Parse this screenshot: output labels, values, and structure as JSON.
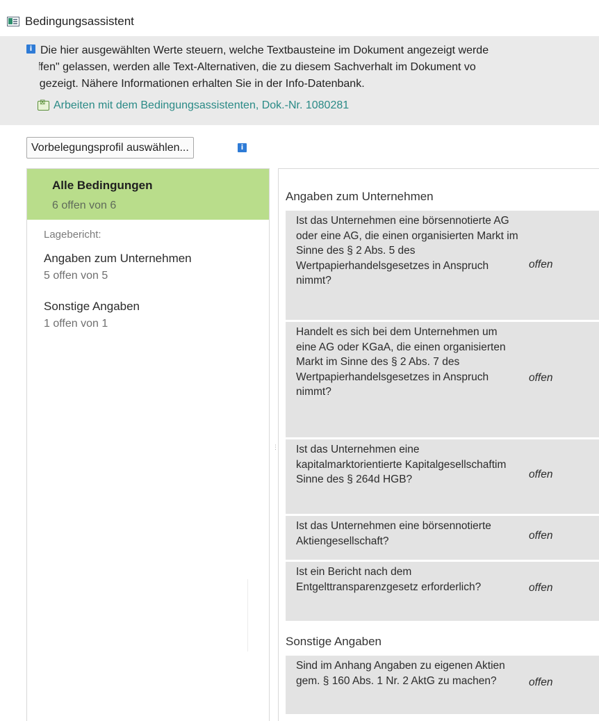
{
  "window": {
    "title": "Bedingungsassistent"
  },
  "banner": {
    "lines": [
      "Die hier ausgewählten Werte steuern, welche Textbausteine im Dokument angezeigt werde",
      "\"offen\" gelassen, werden alle Text-Alternativen, die zu diesem Sachverhalt im Dokument vo",
      "angezeigt. Nähere Informationen erhalten Sie in der Info-Datenbank."
    ],
    "link": "Arbeiten mit dem Bedingungsassistenten, Dok.-Nr. 1080281"
  },
  "profile_button": {
    "label": "Vorbelegungsprofil auswählen..."
  },
  "nav": {
    "all": {
      "label": "Alle Bedingungen",
      "count": "6 offen von 6"
    },
    "section_label": "Lagebericht:",
    "items": [
      {
        "label": "Angaben zum Unternehmen",
        "count": "5 offen von 5"
      },
      {
        "label": "Sonstige Angaben",
        "count": "1 offen von 1"
      }
    ]
  },
  "panel": {
    "sections": [
      {
        "title": "Angaben zum Unternehmen",
        "rows": [
          {
            "question": "Ist das Unternehmen eine börsennotierte AG oder eine AG, die einen organisierten Markt im Sinne des § 2 Abs. 5 des Wertpapierhandelsgesetzes in Anspruch nimmt?",
            "value": "offen"
          },
          {
            "question": "Handelt es sich bei dem Unternehmen um eine AG oder KGaA, die einen organisierten Markt im Sinne des § 2 Abs. 7 des Wertpapierhandelsgesetzes in Anspruch nimmt?",
            "value": "offen"
          },
          {
            "question": "Ist das Unternehmen eine kapitalmarktorientierte Kapitalgesellschaftim Sinne des § 264d HGB?",
            "value": "offen"
          },
          {
            "question": "Ist das Unternehmen eine börsennotierte Aktiengesellschaft?",
            "value": "offen"
          },
          {
            "question": "Ist ein Bericht nach dem Entgelttransparenzgesetz erforderlich?",
            "value": "offen"
          }
        ]
      },
      {
        "title": "Sonstige Angaben",
        "rows": [
          {
            "question": "Sind im Anhang Angaben zu eigenen Aktien gem. § 160 Abs. 1 Nr. 2 AktG zu machen?",
            "value": "offen"
          }
        ]
      }
    ]
  },
  "colors": {
    "nav_selected": "#b9dd8b",
    "banner_bg": "#eaeaea",
    "row_bg": "#e3e3e3",
    "link": "#2a8a86",
    "info_icon": "#2e7bd6"
  }
}
